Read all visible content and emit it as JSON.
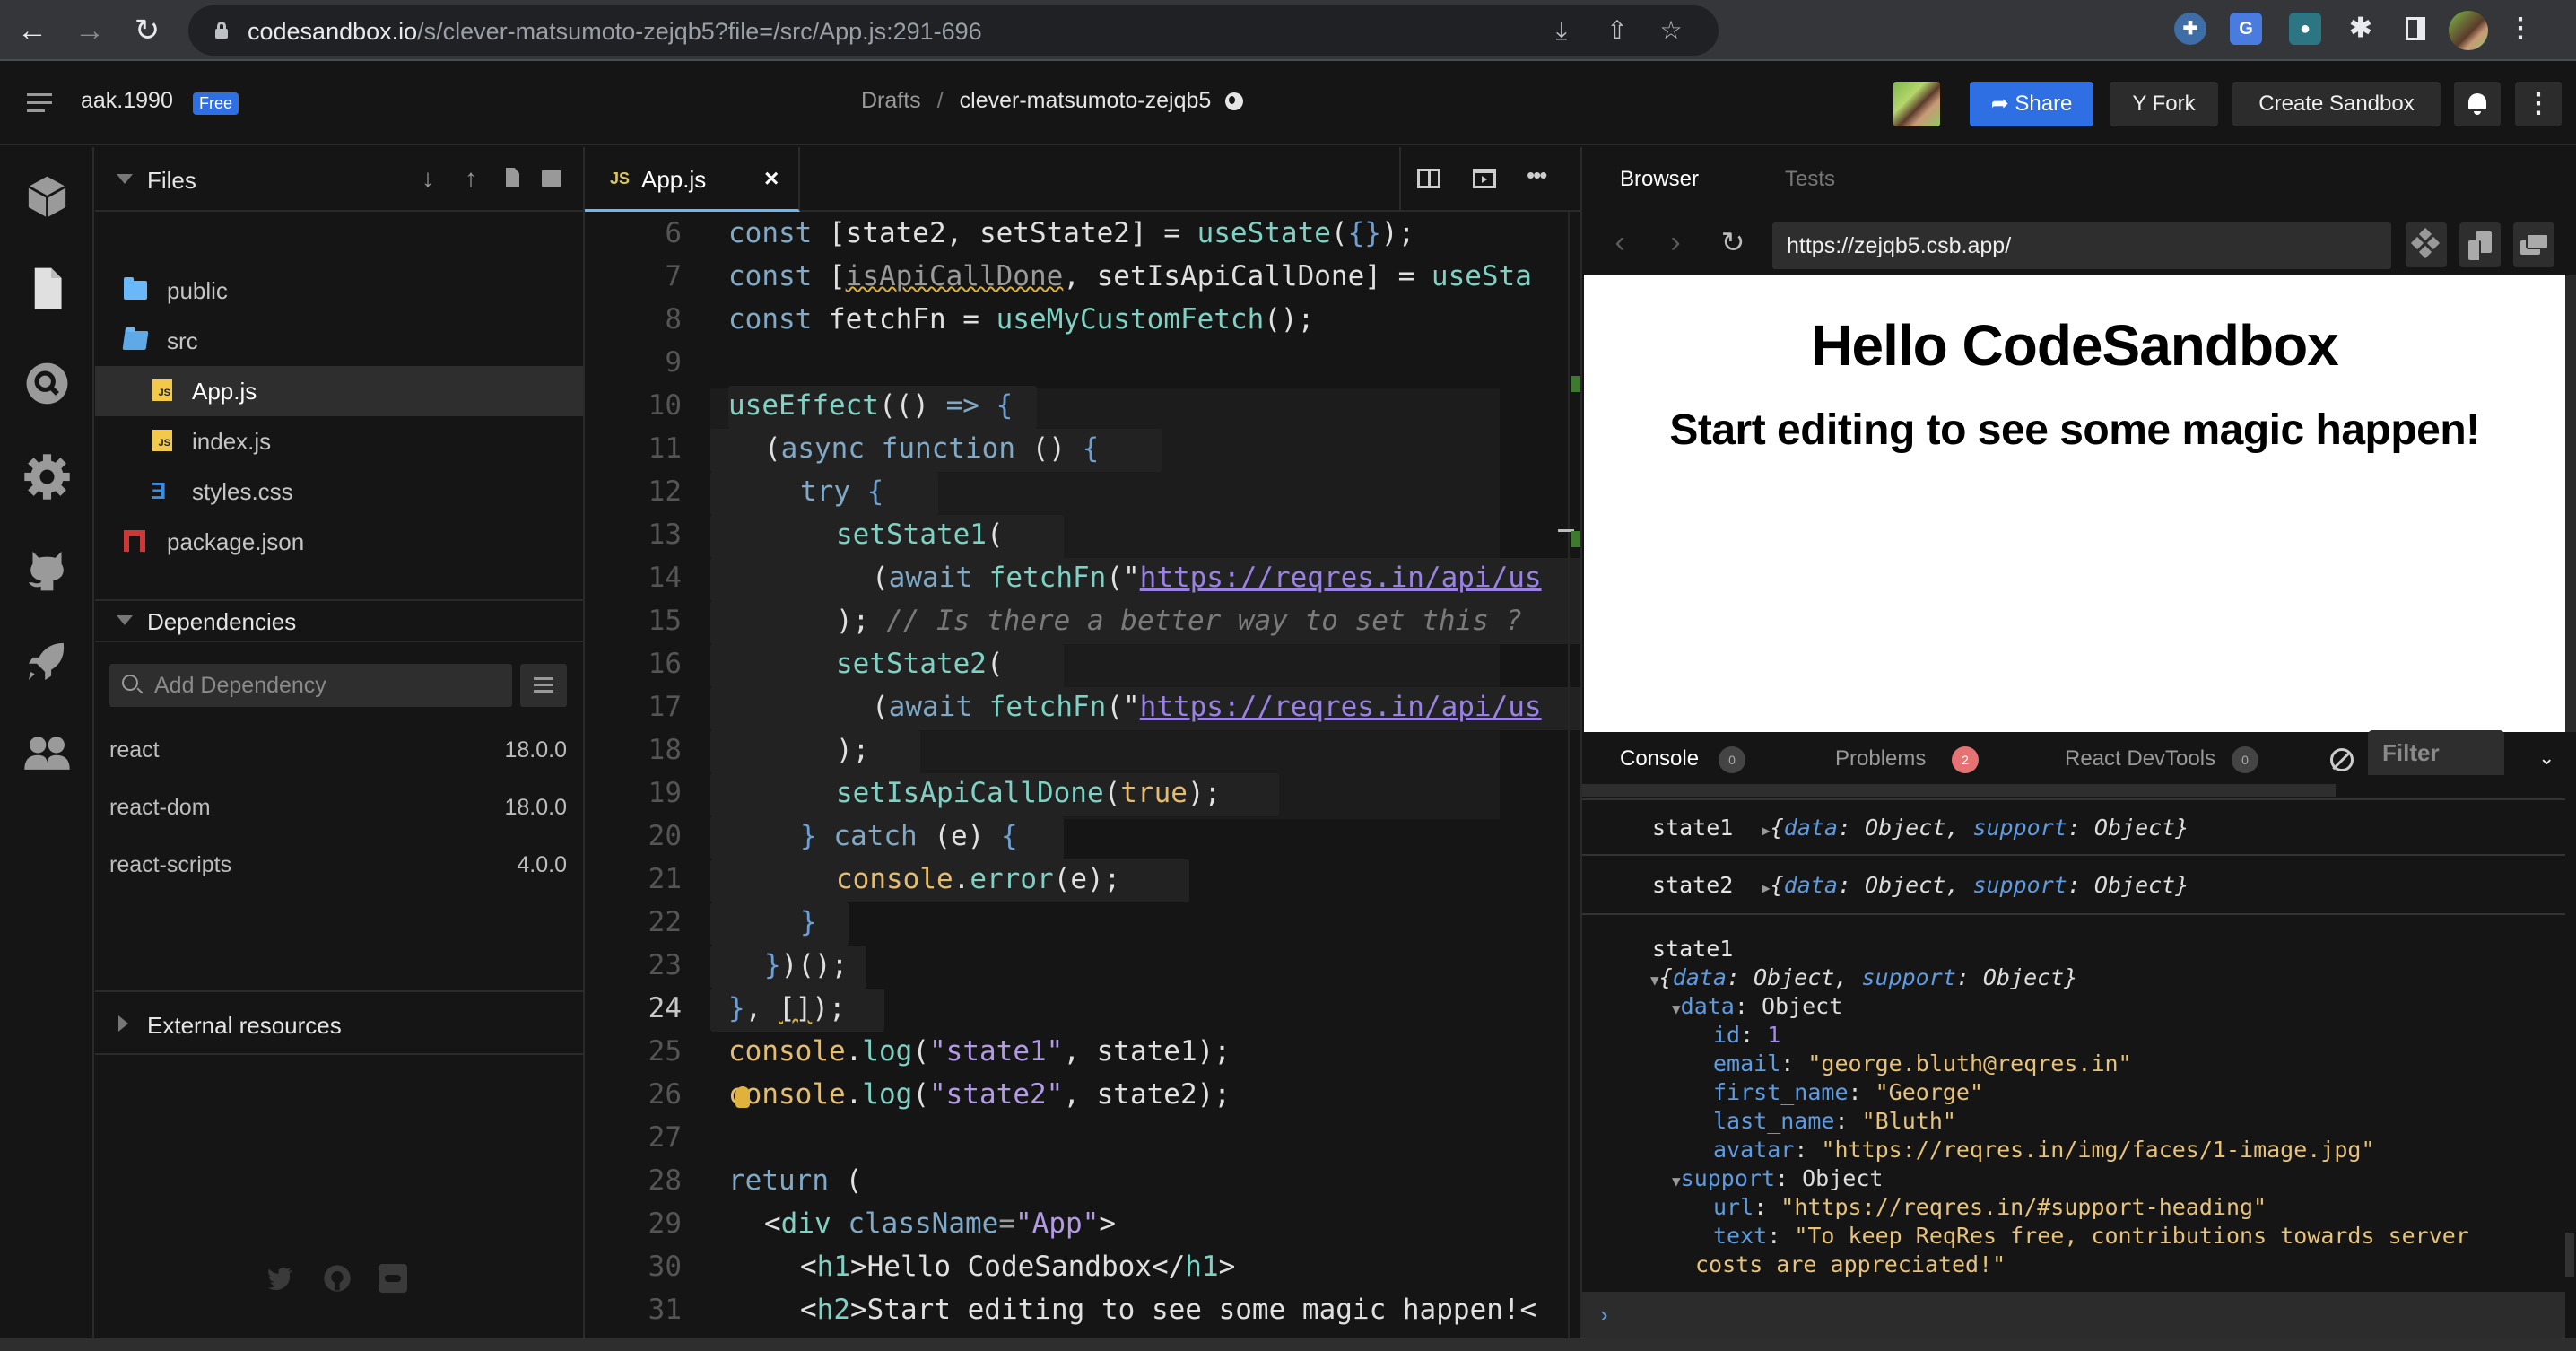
{
  "browser_chrome": {
    "url_host": "codesandbox.io",
    "url_path": "/s/clever-matsumoto-zejqb5?file=/src/App.js:291-696",
    "nav": {
      "back_icon": "arrow-left-icon",
      "forward_icon": "arrow-right-icon",
      "reload_icon": "reload-icon"
    },
    "omnibox_icons": [
      "install-app-icon",
      "share-icon",
      "bookmark-star-icon"
    ],
    "extensions": [
      "extension-blue-cross-icon",
      "google-translate-icon",
      "extension-teal-icon",
      "puzzle-extensions-icon",
      "side-panel-icon",
      "profile-avatar",
      "kebab-menu-icon"
    ],
    "translate_label": "G"
  },
  "header": {
    "username": "aak.1990",
    "plan_badge": "Free",
    "breadcrumb": {
      "parent": "Drafts",
      "separator": "/",
      "sandbox_name": "clever-matsumoto-zejqb5"
    },
    "buttons": {
      "share": "Share",
      "fork": "Fork",
      "create_sandbox": "Create Sandbox"
    },
    "accent_color": "#2f6fe4"
  },
  "activity_bar": {
    "items": [
      "box-icon",
      "file-icon",
      "search-icon",
      "gear-icon",
      "github-icon",
      "rocket-icon",
      "users-icon"
    ]
  },
  "sidebar": {
    "files": {
      "title": "Files",
      "toolbar": [
        "download-icon",
        "upload-icon",
        "new-file-icon",
        "new-folder-icon"
      ],
      "tree": [
        {
          "name": "public",
          "type": "folder",
          "depth": 0
        },
        {
          "name": "src",
          "type": "folder-open",
          "depth": 0
        },
        {
          "name": "App.js",
          "type": "js",
          "depth": 1,
          "active": true
        },
        {
          "name": "index.js",
          "type": "js",
          "depth": 1
        },
        {
          "name": "styles.css",
          "type": "css",
          "depth": 1
        },
        {
          "name": "package.json",
          "type": "npm",
          "depth": 0
        }
      ]
    },
    "dependencies": {
      "title": "Dependencies",
      "search_placeholder": "Add Dependency",
      "items": [
        {
          "name": "react",
          "version": "18.0.0"
        },
        {
          "name": "react-dom",
          "version": "18.0.0"
        },
        {
          "name": "react-scripts",
          "version": "4.0.0"
        }
      ]
    },
    "external_resources": {
      "title": "External resources"
    },
    "social": [
      "twitter-icon",
      "github-icon",
      "discord-icon"
    ]
  },
  "editor": {
    "tab": {
      "badge": "JS",
      "name": "App.js",
      "close": "×"
    },
    "actions": [
      "split-view-icon",
      "preview-icon",
      "more-icon"
    ],
    "current_line": 24,
    "lines": [
      {
        "n": 6
      },
      {
        "n": 7
      },
      {
        "n": 8
      },
      {
        "n": 9
      },
      {
        "n": 10
      },
      {
        "n": 11
      },
      {
        "n": 12
      },
      {
        "n": 13
      },
      {
        "n": 14
      },
      {
        "n": 15
      },
      {
        "n": 16
      },
      {
        "n": 17
      },
      {
        "n": 18
      },
      {
        "n": 19
      },
      {
        "n": 20
      },
      {
        "n": 21
      },
      {
        "n": 22
      },
      {
        "n": 23
      },
      {
        "n": 24
      },
      {
        "n": 25
      },
      {
        "n": 26
      },
      {
        "n": 27
      },
      {
        "n": 28
      },
      {
        "n": 29
      },
      {
        "n": 30
      },
      {
        "n": 31
      }
    ],
    "code": {
      "l6": [
        "const",
        " [state2, setState2] = ",
        "useState",
        "(",
        "{}",
        ");"
      ],
      "l7": [
        "const",
        " [",
        "isApiCallDone",
        ", setIsApiCallDone] = ",
        "useSta"
      ],
      "l8": [
        "const",
        " fetchFn = ",
        "useMyCustomFetch",
        "();"
      ],
      "l10": [
        "useEffect",
        "(() ",
        "=>",
        " {"
      ],
      "l11": [
        "(",
        "async",
        " ",
        "function",
        " () ",
        "{"
      ],
      "l12": [
        "try",
        " {"
      ],
      "l13": [
        "setState1",
        "("
      ],
      "l14": [
        "(",
        "await",
        " ",
        "fetchFn",
        "(\"",
        "https://reqres.in/api/us"
      ],
      "l15": [
        "); ",
        "// Is there a better way to set this ?"
      ],
      "l16": [
        "setState2",
        "("
      ],
      "l17": [
        "(",
        "await",
        " ",
        "fetchFn",
        "(\"",
        "https://reqres.in/api/us"
      ],
      "l18": [
        ");"
      ],
      "l19": [
        "setIsApiCallDone",
        "(",
        "true",
        ");"
      ],
      "l20": [
        "}",
        " ",
        "catch",
        " (e) ",
        "{"
      ],
      "l21": [
        "console",
        ".",
        "error",
        "(e);"
      ],
      "l22": [
        "}"
      ],
      "l23": [
        "}",
        ")();"
      ],
      "l24": [
        "}",
        ", ",
        "[]",
        ");"
      ],
      "l25": [
        "console",
        ".",
        "log",
        "(",
        "\"state1\"",
        ", state1);"
      ],
      "l26": [
        "console",
        ".",
        "log",
        "(",
        "\"state2\"",
        ", state2);"
      ],
      "l28": [
        "return",
        " ("
      ],
      "l29": [
        "<",
        "div",
        " ",
        "className",
        "=",
        "\"App\"",
        ">"
      ],
      "l30": [
        "<",
        "h1",
        ">Hello CodeSandbox</",
        "h1",
        ">"
      ],
      "l31": [
        "<",
        "h2",
        ">Start editing to see some magic happen!<"
      ]
    }
  },
  "right_panel": {
    "tabs": {
      "browser": "Browser",
      "tests": "Tests"
    },
    "preview_url": "https://zejqb5.csb.app/",
    "nav_icons": [
      "chevron-left-icon",
      "chevron-right-icon",
      "refresh-icon"
    ],
    "url_actions": [
      "devtools-icon",
      "open-new-window-icon",
      "duplicate-icon"
    ],
    "preview": {
      "h1": "Hello CodeSandbox",
      "h2": "Start editing to see some magic happen!"
    },
    "console_tabs": [
      {
        "label": "Console",
        "count": "0"
      },
      {
        "label": "Problems",
        "count": "2",
        "color": "#e57373"
      },
      {
        "label": "React DevTools",
        "count": "0"
      }
    ],
    "filter_placeholder": "Filter",
    "console": {
      "collapsed": [
        {
          "label": "state1",
          "k1": "data",
          "v1": "Object",
          "k2": "support",
          "v2": "Object"
        },
        {
          "label": "state2",
          "k1": "data",
          "v1": "Object",
          "k2": "support",
          "v2": "Object"
        }
      ],
      "expanded": {
        "label": "state1",
        "summary": {
          "k1": "data",
          "v1": "Object",
          "k2": "support",
          "v2": "Object"
        },
        "data": {
          "key": "data",
          "type": "Object",
          "fields": [
            {
              "key": "id",
              "value": "1",
              "kind": "number"
            },
            {
              "key": "email",
              "value": "\"george.bluth@reqres.in\"",
              "kind": "string"
            },
            {
              "key": "first_name",
              "value": "\"George\"",
              "kind": "string"
            },
            {
              "key": "last_name",
              "value": "\"Bluth\"",
              "kind": "string"
            },
            {
              "key": "avatar",
              "value": "\"https://reqres.in/img/faces/1-image.jpg\"",
              "kind": "string"
            }
          ]
        },
        "support": {
          "key": "support",
          "type": "Object",
          "fields": [
            {
              "key": "url",
              "value": "\"https://reqres.in/#support-heading\"",
              "kind": "string"
            },
            {
              "key": "text",
              "value": "\"To keep ReqRes free, contributions towards server",
              "kind": "string"
            }
          ],
          "text_wrap": "costs are appreciated!\""
        }
      },
      "prompt": "›"
    }
  }
}
